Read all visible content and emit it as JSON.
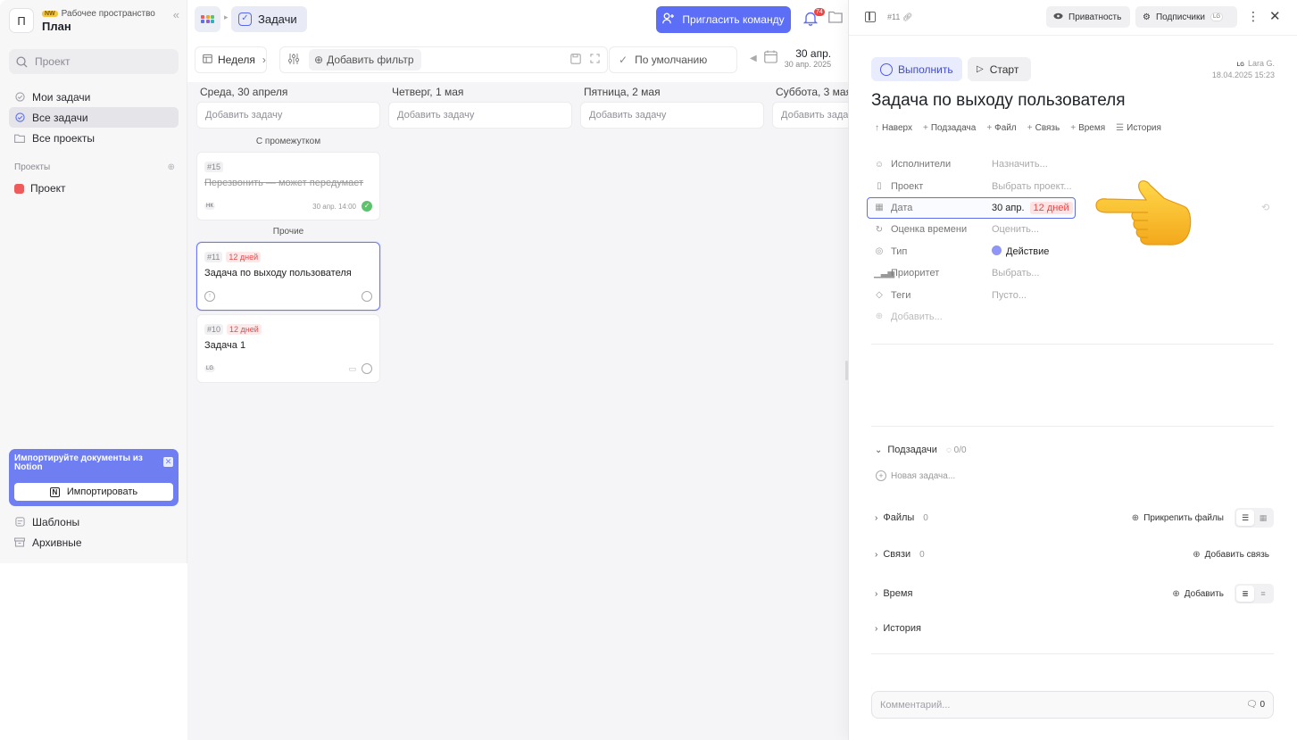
{
  "workspace": {
    "avatar_letter": "П",
    "badge": "NW",
    "subtitle": "Рабочее пространство",
    "title": "План"
  },
  "sidebar": {
    "search_placeholder": "Проект",
    "nav": [
      {
        "label": "Мои задачи",
        "icon": "my-tasks-icon"
      },
      {
        "label": "Все задачи",
        "icon": "all-tasks-icon",
        "active": true
      },
      {
        "label": "Все проекты",
        "icon": "folder-icon"
      }
    ],
    "projects_heading": "Проекты",
    "projects": [
      {
        "label": "Проект",
        "color": "#ef5b5b"
      }
    ],
    "notion_banner": {
      "text": "Импортируйте документы из Notion",
      "button": "Импортировать"
    },
    "bottom": [
      {
        "label": "Шаблоны",
        "icon": "templates-icon"
      },
      {
        "label": "Архивные",
        "icon": "archive-icon"
      }
    ]
  },
  "topbar": {
    "section": "Задачи",
    "invite_label": "Пригласить команду",
    "notif_count": "74"
  },
  "toolbar": {
    "week_label": "Неделя",
    "add_filter": "Добавить фильтр",
    "sort_label": "По умолчанию",
    "date_main": "30 апр.",
    "date_sub": "30 апр. 2025"
  },
  "board": {
    "add_task_label": "Добавить задачу",
    "columns": [
      {
        "head": "Среда, 30 апреля"
      },
      {
        "head": "Четверг, 1 мая"
      },
      {
        "head": "Пятница, 2 мая"
      },
      {
        "head": "Суббота, 3 мая"
      }
    ],
    "groups": {
      "interval": "С промежутком",
      "other": "Прочие"
    },
    "cards": [
      {
        "id": "#15",
        "title": "Перезвонить — может передумает",
        "avatar": "НК",
        "date": "30 апр. 14:00"
      },
      {
        "id": "#11",
        "days": "12 дней",
        "title": "Задача по выходу пользователя"
      },
      {
        "id": "#10",
        "days": "12 дней",
        "title": "Задача 1",
        "avatar": "LG"
      }
    ]
  },
  "panel": {
    "task_id": "#11",
    "privacy": "Приватность",
    "subscribers": "Подписчики",
    "subscriber_avatar": "LG",
    "complete_label": "Выполнить",
    "start_label": "Старт",
    "author_initials": "LG",
    "author_name": "Lara G.",
    "author_date": "18.04.2025 15:23",
    "title": "Задача по выходу пользователя",
    "links": [
      "Наверх",
      "Подзадача",
      "Файл",
      "Связь",
      "Время",
      "История"
    ],
    "props": {
      "assignees": {
        "label": "Исполнители",
        "value": "Назначить..."
      },
      "project": {
        "label": "Проект",
        "value": "Выбрать проект..."
      },
      "date": {
        "label": "Дата",
        "value": "30 апр.",
        "days": "12 дней"
      },
      "estimate": {
        "label": "Оценка времени",
        "value": "Оценить..."
      },
      "type": {
        "label": "Тип",
        "value": "Действие"
      },
      "priority": {
        "label": "Приоритет",
        "value": "Выбрать..."
      },
      "tags": {
        "label": "Теги",
        "value": "Пусто..."
      },
      "add": {
        "label": "Добавить..."
      }
    },
    "subtasks": {
      "label": "Подзадачи",
      "count": "0/0",
      "new_task": "Новая задача..."
    },
    "files": {
      "label": "Файлы",
      "count": "0",
      "action": "Прикрепить файлы"
    },
    "relations": {
      "label": "Связи",
      "count": "0",
      "action": "Добавить связь"
    },
    "time": {
      "label": "Время",
      "action": "Добавить"
    },
    "history": {
      "label": "История"
    },
    "comment_placeholder": "Комментарий...",
    "comment_count": "0"
  },
  "colors": {
    "accent": "#5b6ef5",
    "danger": "#e14b4b",
    "success": "#5cc26b"
  }
}
